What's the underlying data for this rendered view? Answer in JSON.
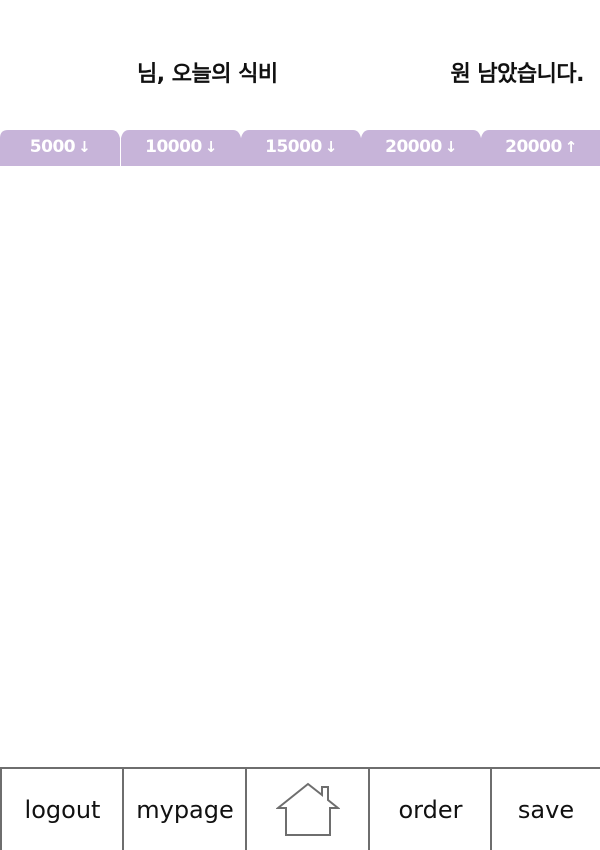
{
  "header": {
    "text_left": "님, 오늘의 식비",
    "text_right": "원 남았습니다."
  },
  "tabs": [
    {
      "label": "5000",
      "arrow": "↓"
    },
    {
      "label": "10000",
      "arrow": "↓"
    },
    {
      "label": "15000",
      "arrow": "↓"
    },
    {
      "label": "20000",
      "arrow": "↓"
    },
    {
      "label": "20000",
      "arrow": "↑"
    }
  ],
  "tab_color": "#c7b4d9",
  "bottom_nav": {
    "logout": "logout",
    "mypage": "mypage",
    "home_icon": "home-icon",
    "order": "order",
    "save": "save"
  }
}
